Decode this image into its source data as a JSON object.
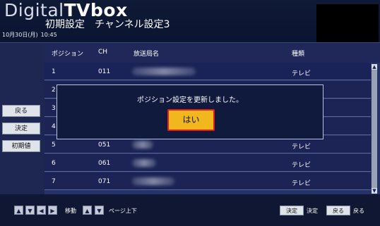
{
  "header": {
    "brand_light": "Digital",
    "brand_bold": "TVbox",
    "title_main": "初期設定",
    "title_sub": "チャンネル設定3",
    "date": "10月30日(月)",
    "time": "10:45"
  },
  "sidebar": {
    "back": "戻る",
    "confirm": "決定",
    "reset": "初期値"
  },
  "table": {
    "headers": {
      "position": "ポジション",
      "ch": "CH",
      "station": "放送局名",
      "type": "種類"
    },
    "rows": [
      {
        "pos": "1",
        "ch": "011",
        "type": "テレビ"
      },
      {
        "pos": "2",
        "ch": "",
        "type": ""
      },
      {
        "pos": "3",
        "ch": "",
        "type": ""
      },
      {
        "pos": "4",
        "ch": "",
        "type": ""
      },
      {
        "pos": "5",
        "ch": "051",
        "type": "テレビ"
      },
      {
        "pos": "6",
        "ch": "061",
        "type": "テレビ"
      },
      {
        "pos": "7",
        "ch": "071",
        "type": "テレビ"
      }
    ]
  },
  "dialog": {
    "message": "ポジション設定を更新しました。",
    "yes": "はい"
  },
  "footer": {
    "move": "移動",
    "page": "ページ上下",
    "confirm_key": "決定",
    "confirm_label": "決定",
    "back_key": "戻る",
    "back_label": "戻る"
  },
  "icons": {
    "up": "arrow-up-icon",
    "down": "arrow-down-icon",
    "left": "arrow-left-icon",
    "right": "arrow-right-icon",
    "scroll_up": "scroll-up-icon",
    "scroll_down": "scroll-down-icon"
  },
  "colors": {
    "background": "#0f1733",
    "panel": "#263369",
    "yes_button": "#f1b71f",
    "focus_border": "#e31e1e"
  }
}
